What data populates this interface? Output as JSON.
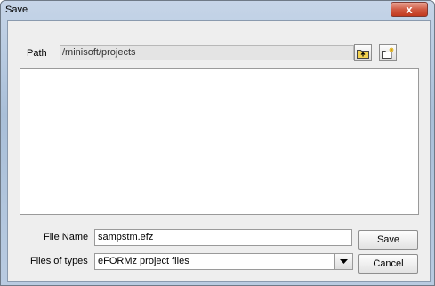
{
  "window": {
    "title": "Save",
    "close_label": "x"
  },
  "path": {
    "label": "Path",
    "value": "/minisoft/projects",
    "up_icon": "folder-up-icon",
    "new_folder_icon": "new-folder-icon"
  },
  "file_list": {
    "items": []
  },
  "file_name": {
    "label": "File Name",
    "value": "sampstm.efz"
  },
  "file_types": {
    "label": "Files of types",
    "selected": "eFORMz project files"
  },
  "buttons": {
    "save": "Save",
    "cancel": "Cancel"
  }
}
